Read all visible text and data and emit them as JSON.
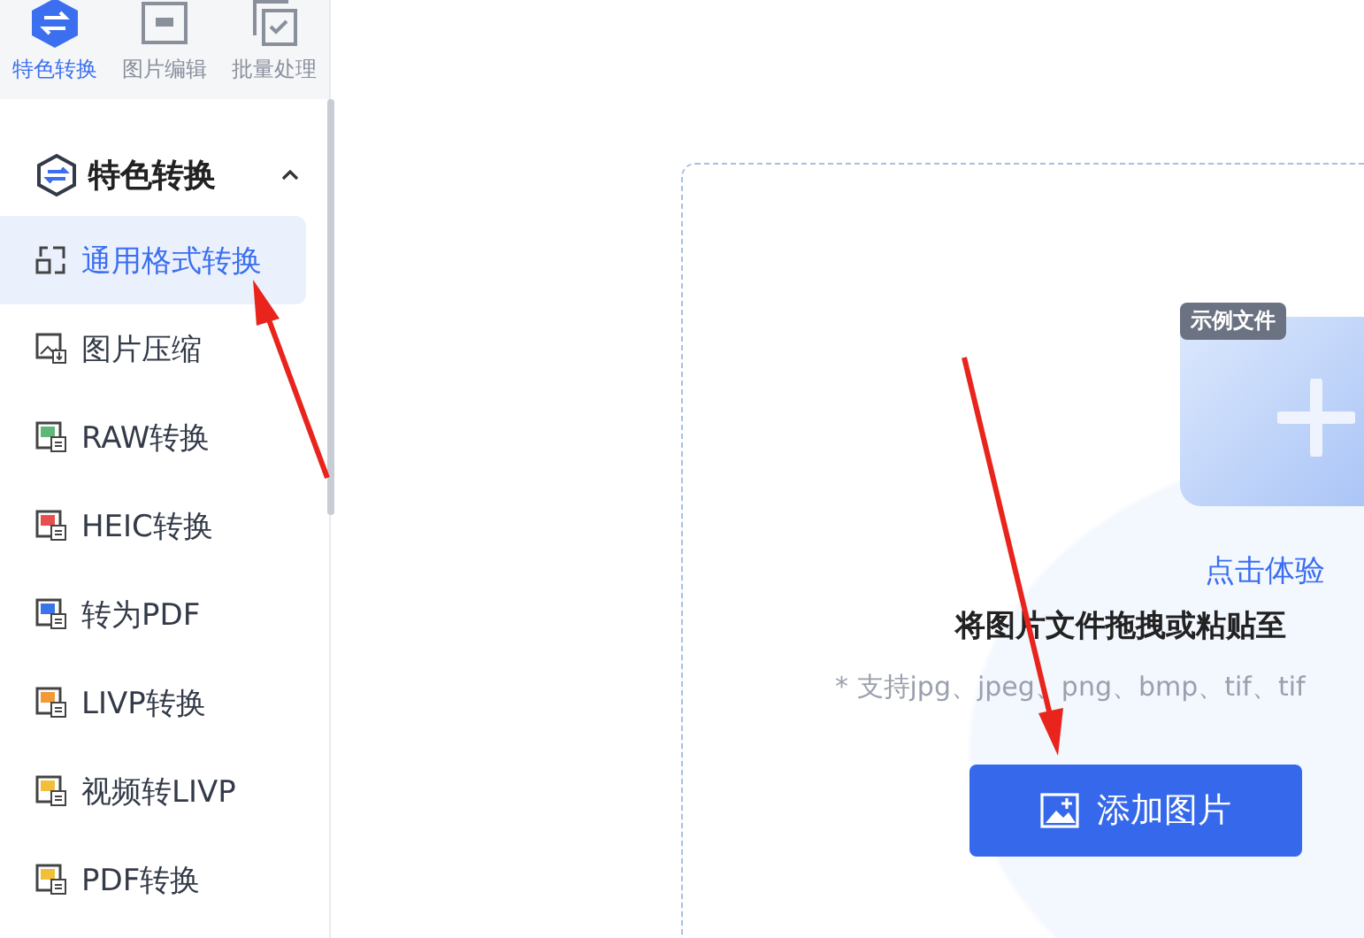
{
  "top_tabs": [
    {
      "label": "特色转换",
      "selected": true,
      "kind": "convert"
    },
    {
      "label": "图片编辑",
      "selected": false,
      "kind": "edit"
    },
    {
      "label": "批量处理",
      "selected": false,
      "kind": "batch"
    }
  ],
  "section": {
    "title": "特色转换",
    "expanded": true
  },
  "menu": [
    {
      "label": "通用格式转换",
      "selected": true,
      "kind": "swap"
    },
    {
      "label": "图片压缩",
      "selected": false,
      "kind": "compress"
    },
    {
      "label": "RAW转换",
      "selected": false,
      "kind": "file",
      "color": "#5fb878"
    },
    {
      "label": "HEIC转换",
      "selected": false,
      "kind": "file",
      "color": "#e8504f"
    },
    {
      "label": "转为PDF",
      "selected": false,
      "kind": "file",
      "color": "#3b73e8"
    },
    {
      "label": "LIVP转换",
      "selected": false,
      "kind": "file",
      "color": "#f29a38"
    },
    {
      "label": "视频转LIVP",
      "selected": false,
      "kind": "file",
      "color": "#f2c038"
    },
    {
      "label": "PDF转换",
      "selected": false,
      "kind": "file",
      "color": "#f2c038"
    }
  ],
  "drop_zone": {
    "sample_tag": "示例文件",
    "sample_link": "点击体验",
    "instruction": "将图片文件拖拽或粘贴至",
    "formats": "* 支持jpg、jpeg、png、bmp、tif、tif",
    "add_button": "添加图片"
  }
}
